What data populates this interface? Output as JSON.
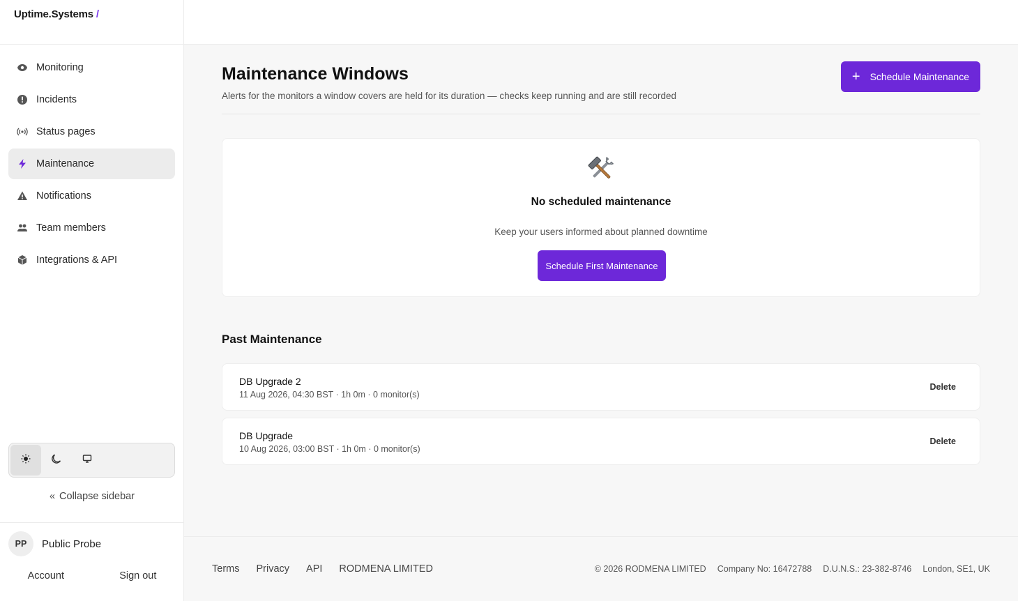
{
  "brand": {
    "name": "Uptime.Systems",
    "slash": "/"
  },
  "nav": {
    "items": [
      {
        "label": "Monitoring",
        "icon": "eye-icon",
        "active": false
      },
      {
        "label": "Incidents",
        "icon": "alert-circle-icon",
        "active": false
      },
      {
        "label": "Status pages",
        "icon": "broadcast-icon",
        "active": false
      },
      {
        "label": "Maintenance",
        "icon": "lightning-icon",
        "active": true
      },
      {
        "label": "Notifications",
        "icon": "warning-triangle-icon",
        "active": false
      },
      {
        "label": "Team members",
        "icon": "users-icon",
        "active": false
      },
      {
        "label": "Integrations & API",
        "icon": "cube-icon",
        "active": false
      }
    ]
  },
  "theme": {
    "options": [
      "light",
      "dark",
      "system"
    ],
    "selected": "light"
  },
  "sidebar": {
    "collapse_chevron": "«",
    "collapse_label": "Collapse sidebar"
  },
  "user": {
    "initials": "PP",
    "name": "Public Probe",
    "account_label": "Account",
    "signout_label": "Sign out"
  },
  "page": {
    "title": "Maintenance Windows",
    "subtitle": "Alerts for the monitors a window covers are held for its duration — checks keep running and are still recorded",
    "schedule_button_icon": "+",
    "schedule_button": "Schedule Maintenance"
  },
  "empty_state": {
    "icon": "hammer-wrench-icon",
    "title": "No scheduled maintenance",
    "subtitle": "Keep your users informed about planned downtime",
    "button": "Schedule First Maintenance"
  },
  "past": {
    "title": "Past Maintenance",
    "rows": [
      {
        "name": "DB Upgrade 2",
        "meta": "11 Aug 2026, 04:30 BST · 1h 0m · 0 monitor(s)",
        "delete_label": "Delete"
      },
      {
        "name": "DB Upgrade",
        "meta": "10 Aug 2026, 03:00 BST · 1h 0m · 0 monitor(s)",
        "delete_label": "Delete"
      }
    ]
  },
  "footer": {
    "links": [
      "Terms",
      "Privacy",
      "API",
      "RODMENA LIMITED"
    ],
    "legal": [
      "© 2026 RODMENA LIMITED",
      "Company No: 16472788",
      "D.U.N.S.: 23-382-8746",
      "London, SE1, UK"
    ]
  },
  "colors": {
    "accent": "#6d28d9",
    "active_nav_bg": "#ececec",
    "brand_slash": "#7c3aed"
  }
}
